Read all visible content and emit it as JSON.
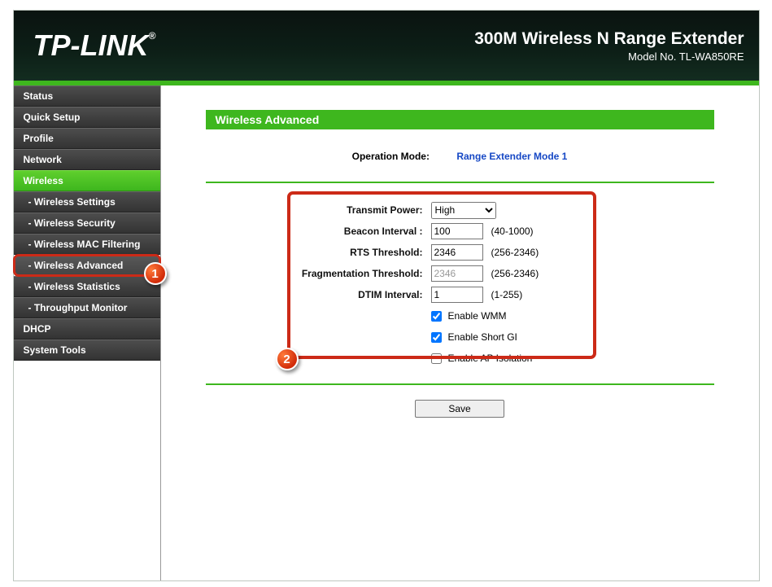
{
  "header": {
    "logo": "TP-LINK",
    "logo_reg": "®",
    "title": "300M Wireless N Range Extender",
    "model": "Model No. TL-WA850RE"
  },
  "sidebar": {
    "items": [
      {
        "label": "Status",
        "type": "top"
      },
      {
        "label": "Quick Setup",
        "type": "top"
      },
      {
        "label": "Profile",
        "type": "top"
      },
      {
        "label": "Network",
        "type": "top"
      },
      {
        "label": "Wireless",
        "type": "active"
      },
      {
        "label": "- Wireless Settings",
        "type": "sub"
      },
      {
        "label": "- Wireless Security",
        "type": "sub"
      },
      {
        "label": "- Wireless MAC Filtering",
        "type": "sub"
      },
      {
        "label": "- Wireless Advanced",
        "type": "sub-hl"
      },
      {
        "label": "- Wireless Statistics",
        "type": "sub"
      },
      {
        "label": "- Throughput Monitor",
        "type": "sub"
      },
      {
        "label": "DHCP",
        "type": "top"
      },
      {
        "label": "System Tools",
        "type": "top"
      }
    ]
  },
  "page": {
    "title": "Wireless Advanced",
    "mode_label": "Operation Mode:",
    "mode_value": "Range Extender Mode 1",
    "fields": {
      "transmit_power": {
        "label": "Transmit Power:",
        "value": "High"
      },
      "beacon": {
        "label": "Beacon Interval :",
        "value": "100",
        "hint": "(40-1000)"
      },
      "rts": {
        "label": "RTS Threshold:",
        "value": "2346",
        "hint": "(256-2346)"
      },
      "frag": {
        "label": "Fragmentation Threshold:",
        "value": "2346",
        "hint": "(256-2346)"
      },
      "dtim": {
        "label": "DTIM Interval:",
        "value": "1",
        "hint": "(1-255)"
      },
      "wmm": {
        "label": "Enable WMM",
        "checked": true
      },
      "sgi": {
        "label": "Enable Short GI",
        "checked": true
      },
      "apiso": {
        "label": "Enable AP Isolation",
        "checked": false
      }
    },
    "save_label": "Save"
  },
  "annotations": {
    "badge1": "1",
    "badge2": "2"
  }
}
